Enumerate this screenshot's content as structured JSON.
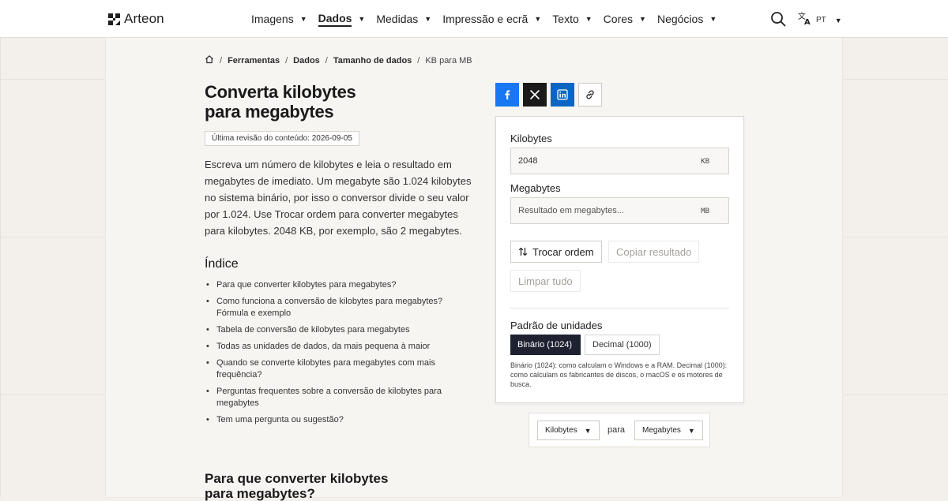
{
  "brand": {
    "name": "Arteon"
  },
  "nav": {
    "items": [
      {
        "label": "Imagens",
        "caret": "▼",
        "has_dropdown": true
      },
      {
        "label": "Dados",
        "caret": "▼",
        "has_dropdown": true,
        "active": true
      },
      {
        "label": "Medidas",
        "caret": "▼",
        "has_dropdown": true
      },
      {
        "label": "Impressão e ecrã",
        "caret": "▼",
        "has_dropdown": true
      },
      {
        "label": "Texto",
        "caret": "▼",
        "has_dropdown": true
      },
      {
        "label": "Cores",
        "caret": "▼",
        "has_dropdown": true
      },
      {
        "label": "Negócios",
        "caret": "▼",
        "has_dropdown": true
      }
    ],
    "search_icon": "search-icon",
    "language": {
      "code": "PT",
      "caret": "▼",
      "icon": "translate-icon"
    }
  },
  "breadcrumb": {
    "home_icon": "home-icon",
    "separator": "/",
    "items": [
      "Ferramentas",
      "Dados",
      "Tamanho de dados"
    ],
    "current": "KB para MB"
  },
  "page": {
    "title_line1": "Converta kilobytes",
    "title_line2": "para megabytes",
    "revision": "Última revisão do conteúdo: 2026-09-05",
    "lead": "Escreva um número de kilobytes e leia o resultado em megabytes de imediato. Um megabyte são 1.024 kilobytes no sistema binário, por isso o conversor divide o seu valor por 1.024. Use Trocar ordem para converter megabytes para kilobytes. 2048 KB, por exemplo, são 2 megabytes."
  },
  "toc": {
    "title": "Índice",
    "items": [
      "Para que converter kilobytes para megabytes?",
      "Como funciona a conversão de kilobytes para megabytes? Fórmula e exemplo",
      "Tabela de conversão de kilobytes para megabytes",
      "Todas as unidades de dados, da mais pequena à maior",
      "Quando se converte kilobytes para megabytes com mais frequência?",
      "Perguntas frequentes sobre a conversão de kilobytes para megabytes",
      "Tem uma pergunta ou sugestão?"
    ]
  },
  "section": {
    "title": "Para que converter kilobytes para megabytes?"
  },
  "share": {
    "facebook_icon": "facebook-icon",
    "x_icon": "x-icon",
    "linkedin_icon": "linkedin-icon",
    "link_icon": "link-icon",
    "colors": {
      "facebook": "#1877f2",
      "x": "#1a1a1a",
      "linkedin": "#0a66c2"
    }
  },
  "converter": {
    "input_label": "Kilobytes",
    "input_value": "2048",
    "input_unit": "KB",
    "output_label": "Megabytes",
    "output_placeholder": "Resultado em megabytes...",
    "output_unit": "MB",
    "swap_label": "Trocar ordem",
    "swap_icon": "swap-vertical-icon",
    "copy_label": "Copiar resultado",
    "clear_label": "Limpar tudo",
    "standard_label": "Padrão de unidades",
    "binary_label": "Binário (1024)",
    "decimal_label": "Decimal (1000)",
    "selected_standard": "binary",
    "hint": "Binário (1024): como calculam o Windows e a RAM. Decimal (1000): como calculam os fabricantes de discos, o macOS e os motores de busca.",
    "active_color": "#1d2130"
  },
  "quick_select": {
    "from": "Kilobytes",
    "to_word": "para",
    "to": "Megabytes",
    "caret": "▼"
  }
}
